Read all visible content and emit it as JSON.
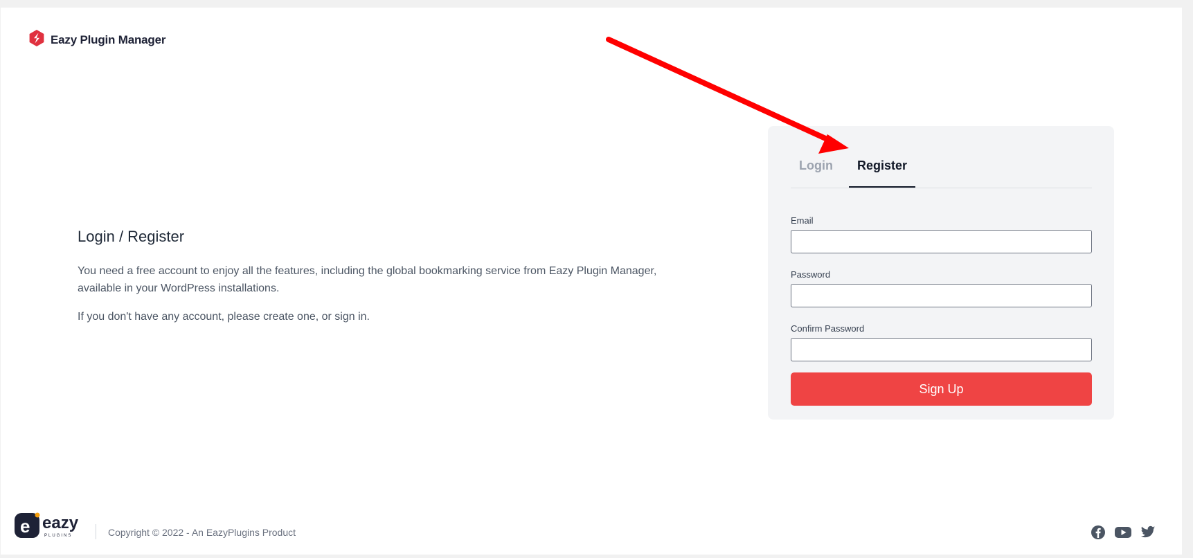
{
  "header": {
    "brand_name": "Eazy Plugin Manager",
    "logo_icon": "eazy-plugin-manager-logo-icon"
  },
  "intro": {
    "title": "Login / Register",
    "paragraph_1": "You need a free account to enjoy all the features, including the global bookmarking service from Eazy Plugin Manager, available in your WordPress installations.",
    "paragraph_2": "If you don't have any account, please create one, or sign in."
  },
  "auth_card": {
    "tabs": [
      {
        "label": "Login",
        "active": false
      },
      {
        "label": "Register",
        "active": true
      }
    ],
    "fields": {
      "email": {
        "label": "Email",
        "value": "",
        "placeholder": ""
      },
      "password": {
        "label": "Password",
        "value": "",
        "placeholder": ""
      },
      "confirm_password": {
        "label": "Confirm Password",
        "value": "",
        "placeholder": ""
      }
    },
    "submit_label": "Sign Up"
  },
  "footer": {
    "logo_text": "eazy",
    "logo_subtext": "PLUGINS",
    "copyright": "Copyright © 2022 - An EazyPlugins Product",
    "social_icons": [
      "facebook-icon",
      "youtube-icon",
      "twitter-icon"
    ]
  },
  "colors": {
    "accent": "#ef4444",
    "annotation_arrow": "#ff0000",
    "card_bg": "#f3f4f6",
    "brand_dark": "#1e2236"
  }
}
